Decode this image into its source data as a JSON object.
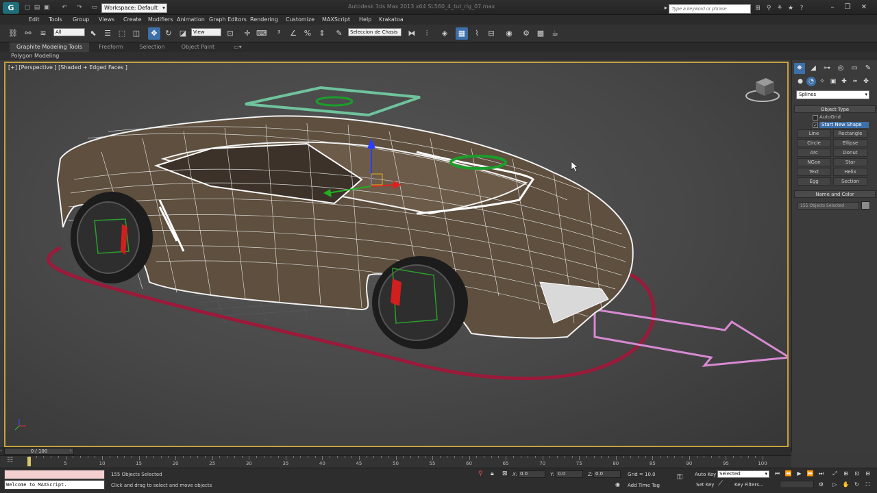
{
  "title_bar": {
    "workspace": "Workspace: Default",
    "window_title": "Autodesk 3ds Max 2013 x64     SL560_4_tut_rig_07.max",
    "search_placeholder": "Type a keyword or phrase"
  },
  "menu": [
    "Edit",
    "Tools",
    "Group",
    "Views",
    "Create",
    "Modifiers",
    "Animation",
    "Graph Editors",
    "Rendering",
    "Customize",
    "MAXScript",
    "Help",
    "Krakatoa"
  ],
  "toolbar": {
    "selection_filter": "All",
    "ref_coord": "View",
    "named_selection": "Seleccion de Chasis"
  },
  "ribbon": {
    "tabs": [
      "Graphite Modeling Tools",
      "Freeform",
      "Selection",
      "Object Paint"
    ],
    "sub_label": "Polygon Modeling"
  },
  "viewport": {
    "label": "[+] [Perspective ] [Shaded + Edged Faces ]"
  },
  "command_panel": {
    "category": "Splines",
    "object_type_title": "Object Type",
    "autogrid_label": "AutoGrid",
    "start_new_shape_label": "Start New Shape",
    "shape_buttons": [
      "Line",
      "Rectangle",
      "Circle",
      "Ellipse",
      "Arc",
      "Donut",
      "NGon",
      "Star",
      "Text",
      "Helix",
      "Egg",
      "Section"
    ],
    "name_color_title": "Name and Color",
    "name_value": "155 Objects Selected"
  },
  "timeline": {
    "slider": "0 / 100",
    "ticks": [
      "0",
      "5",
      "10",
      "15",
      "20",
      "25",
      "30",
      "35",
      "40",
      "45",
      "50",
      "55",
      "60",
      "65",
      "70",
      "75",
      "80",
      "85",
      "90",
      "95",
      "100"
    ]
  },
  "status": {
    "maxscript": "Welcome to MAXScript.",
    "selection": "155 Objects Selected",
    "prompt": "Click and drag to select and move objects",
    "x_label": "X:",
    "x_value": "0.0",
    "y_label": "Y:",
    "y_value": "0.0",
    "z_label": "Z:",
    "z_value": "0.0",
    "grid": "Grid = 10.0",
    "add_time_tag": "Add Time Tag",
    "auto_key": "Auto Key",
    "set_key": "Set Key",
    "key_mode": "Selected",
    "key_filters": "Key Filters..."
  }
}
